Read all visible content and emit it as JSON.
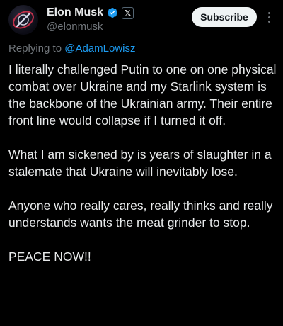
{
  "author": {
    "name": "Elon Musk",
    "handle": "@elonmusk",
    "verified_icon": "verified-badge-icon",
    "affiliation_icon": "x-logo-icon",
    "affiliation_label": "𝕏"
  },
  "actions": {
    "subscribe_label": "Subscribe",
    "more_icon": "more-vertical-icon"
  },
  "reply": {
    "prefix": "Replying to ",
    "mention": "@AdamLowisz"
  },
  "post": {
    "paragraphs": [
      "I literally challenged Putin to one on one physical combat over Ukraine and my Starlink system is the backbone of the Ukrainian army. Their entire front line would collapse if I turned it off.",
      "What I am sickened by is years of slaughter in a stalemate that Ukraine will inevitably lose.",
      "Anyone who really cares, really thinks and really understands wants the meat grinder to stop.",
      "PEACE NOW!!"
    ]
  },
  "colors": {
    "background": "#000000",
    "text": "#e7e9ea",
    "secondary": "#71767b",
    "link": "#1d9bf0",
    "verified": "#1d9bf0",
    "button_bg": "#eff3f4"
  }
}
